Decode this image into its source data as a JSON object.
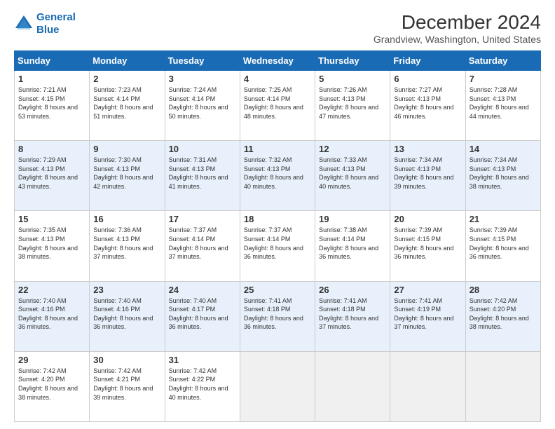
{
  "logo": {
    "line1": "General",
    "line2": "Blue"
  },
  "title": "December 2024",
  "subtitle": "Grandview, Washington, United States",
  "days_of_week": [
    "Sunday",
    "Monday",
    "Tuesday",
    "Wednesday",
    "Thursday",
    "Friday",
    "Saturday"
  ],
  "weeks": [
    [
      {
        "day": 1,
        "info": "Sunrise: 7:21 AM\nSunset: 4:15 PM\nDaylight: 8 hours and 53 minutes."
      },
      {
        "day": 2,
        "info": "Sunrise: 7:23 AM\nSunset: 4:14 PM\nDaylight: 8 hours and 51 minutes."
      },
      {
        "day": 3,
        "info": "Sunrise: 7:24 AM\nSunset: 4:14 PM\nDaylight: 8 hours and 50 minutes."
      },
      {
        "day": 4,
        "info": "Sunrise: 7:25 AM\nSunset: 4:14 PM\nDaylight: 8 hours and 48 minutes."
      },
      {
        "day": 5,
        "info": "Sunrise: 7:26 AM\nSunset: 4:13 PM\nDaylight: 8 hours and 47 minutes."
      },
      {
        "day": 6,
        "info": "Sunrise: 7:27 AM\nSunset: 4:13 PM\nDaylight: 8 hours and 46 minutes."
      },
      {
        "day": 7,
        "info": "Sunrise: 7:28 AM\nSunset: 4:13 PM\nDaylight: 8 hours and 44 minutes."
      }
    ],
    [
      {
        "day": 8,
        "info": "Sunrise: 7:29 AM\nSunset: 4:13 PM\nDaylight: 8 hours and 43 minutes."
      },
      {
        "day": 9,
        "info": "Sunrise: 7:30 AM\nSunset: 4:13 PM\nDaylight: 8 hours and 42 minutes."
      },
      {
        "day": 10,
        "info": "Sunrise: 7:31 AM\nSunset: 4:13 PM\nDaylight: 8 hours and 41 minutes."
      },
      {
        "day": 11,
        "info": "Sunrise: 7:32 AM\nSunset: 4:13 PM\nDaylight: 8 hours and 40 minutes."
      },
      {
        "day": 12,
        "info": "Sunrise: 7:33 AM\nSunset: 4:13 PM\nDaylight: 8 hours and 40 minutes."
      },
      {
        "day": 13,
        "info": "Sunrise: 7:34 AM\nSunset: 4:13 PM\nDaylight: 8 hours and 39 minutes."
      },
      {
        "day": 14,
        "info": "Sunrise: 7:34 AM\nSunset: 4:13 PM\nDaylight: 8 hours and 38 minutes."
      }
    ],
    [
      {
        "day": 15,
        "info": "Sunrise: 7:35 AM\nSunset: 4:13 PM\nDaylight: 8 hours and 38 minutes."
      },
      {
        "day": 16,
        "info": "Sunrise: 7:36 AM\nSunset: 4:13 PM\nDaylight: 8 hours and 37 minutes."
      },
      {
        "day": 17,
        "info": "Sunrise: 7:37 AM\nSunset: 4:14 PM\nDaylight: 8 hours and 37 minutes."
      },
      {
        "day": 18,
        "info": "Sunrise: 7:37 AM\nSunset: 4:14 PM\nDaylight: 8 hours and 36 minutes."
      },
      {
        "day": 19,
        "info": "Sunrise: 7:38 AM\nSunset: 4:14 PM\nDaylight: 8 hours and 36 minutes."
      },
      {
        "day": 20,
        "info": "Sunrise: 7:39 AM\nSunset: 4:15 PM\nDaylight: 8 hours and 36 minutes."
      },
      {
        "day": 21,
        "info": "Sunrise: 7:39 AM\nSunset: 4:15 PM\nDaylight: 8 hours and 36 minutes."
      }
    ],
    [
      {
        "day": 22,
        "info": "Sunrise: 7:40 AM\nSunset: 4:16 PM\nDaylight: 8 hours and 36 minutes."
      },
      {
        "day": 23,
        "info": "Sunrise: 7:40 AM\nSunset: 4:16 PM\nDaylight: 8 hours and 36 minutes."
      },
      {
        "day": 24,
        "info": "Sunrise: 7:40 AM\nSunset: 4:17 PM\nDaylight: 8 hours and 36 minutes."
      },
      {
        "day": 25,
        "info": "Sunrise: 7:41 AM\nSunset: 4:18 PM\nDaylight: 8 hours and 36 minutes."
      },
      {
        "day": 26,
        "info": "Sunrise: 7:41 AM\nSunset: 4:18 PM\nDaylight: 8 hours and 37 minutes."
      },
      {
        "day": 27,
        "info": "Sunrise: 7:41 AM\nSunset: 4:19 PM\nDaylight: 8 hours and 37 minutes."
      },
      {
        "day": 28,
        "info": "Sunrise: 7:42 AM\nSunset: 4:20 PM\nDaylight: 8 hours and 38 minutes."
      }
    ],
    [
      {
        "day": 29,
        "info": "Sunrise: 7:42 AM\nSunset: 4:20 PM\nDaylight: 8 hours and 38 minutes."
      },
      {
        "day": 30,
        "info": "Sunrise: 7:42 AM\nSunset: 4:21 PM\nDaylight: 8 hours and 39 minutes."
      },
      {
        "day": 31,
        "info": "Sunrise: 7:42 AM\nSunset: 4:22 PM\nDaylight: 8 hours and 40 minutes."
      },
      null,
      null,
      null,
      null
    ]
  ]
}
